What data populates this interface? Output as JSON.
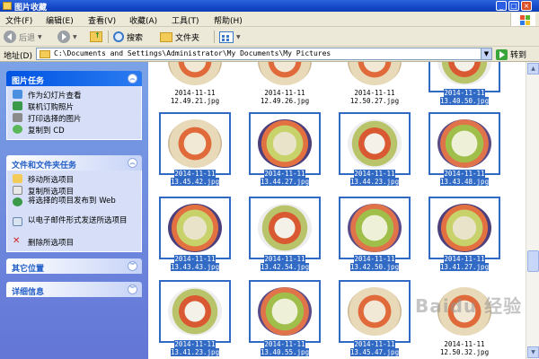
{
  "window": {
    "title": "图片收藏"
  },
  "menu": [
    "文件(F)",
    "编辑(E)",
    "查看(V)",
    "收藏(A)",
    "工具(T)",
    "帮助(H)"
  ],
  "toolbar": {
    "back": "后退",
    "search": "搜索",
    "folders": "文件夹"
  },
  "address": {
    "label": "地址(D)",
    "path": "C:\\Documents and Settings\\Administrator\\My Documents\\My Pictures",
    "go": "转到"
  },
  "taskpane": {
    "picture_tasks": {
      "title": "图片任务",
      "items": [
        "作为幻灯片查看",
        "联机订购照片",
        "打印选择的图片",
        "复制到 CD"
      ]
    },
    "file_tasks": {
      "title": "文件和文件夹任务",
      "items": [
        "移动所选项目",
        "复制所选项目",
        "将选择的项目发布到 Web",
        "以电子邮件形式发送所选项目",
        "删除所选项目"
      ]
    },
    "other_places": {
      "title": "其它位置"
    },
    "details": {
      "title": "详细信息"
    }
  },
  "files": [
    {
      "line1": "2014-11-11",
      "line2": "12.49.21.jpg",
      "selected": false
    },
    {
      "line1": "2014-11-11",
      "line2": "12.49.26.jpg",
      "selected": false
    },
    {
      "line1": "2014-11-11",
      "line2": "12.50.27.jpg",
      "selected": false
    },
    {
      "line1": "2014-11-11",
      "line2": "13.40.50.jpg",
      "selected": true
    },
    {
      "line1": "2014-11-11",
      "line2": "13.45.42.jpg",
      "selected": true
    },
    {
      "line1": "2014-11-11",
      "line2": "13.44.27.jpg",
      "selected": true
    },
    {
      "line1": "2014-11-11",
      "line2": "13.44.23.jpg",
      "selected": true
    },
    {
      "line1": "2014-11-11",
      "line2": "13.43.48.jpg",
      "selected": true
    },
    {
      "line1": "2014-11-11",
      "line2": "13.43.43.jpg",
      "selected": true
    },
    {
      "line1": "2014-11-11",
      "line2": "13.42.54.jpg",
      "selected": true
    },
    {
      "line1": "2014-11-11",
      "line2": "13.42.50.jpg",
      "selected": true
    },
    {
      "line1": "2014-11-11",
      "line2": "13.41.27.jpg",
      "selected": true
    },
    {
      "line1": "2014-11-11",
      "line2": "13.41.23.jpg",
      "selected": true
    },
    {
      "line1": "2014-11-11",
      "line2": "13.40.55.jpg",
      "selected": true
    },
    {
      "line1": "2014-11-11",
      "line2": "13.45.47.jpg",
      "selected": true
    },
    {
      "line1": "2014-11-11",
      "line2": "12.50.32.jpg",
      "selected": false
    }
  ],
  "watermark": "Baidu 经验",
  "colors": {
    "selection": "#316ac5",
    "title_bar": "#0d3fb4",
    "task_pane": "#6375d6"
  }
}
